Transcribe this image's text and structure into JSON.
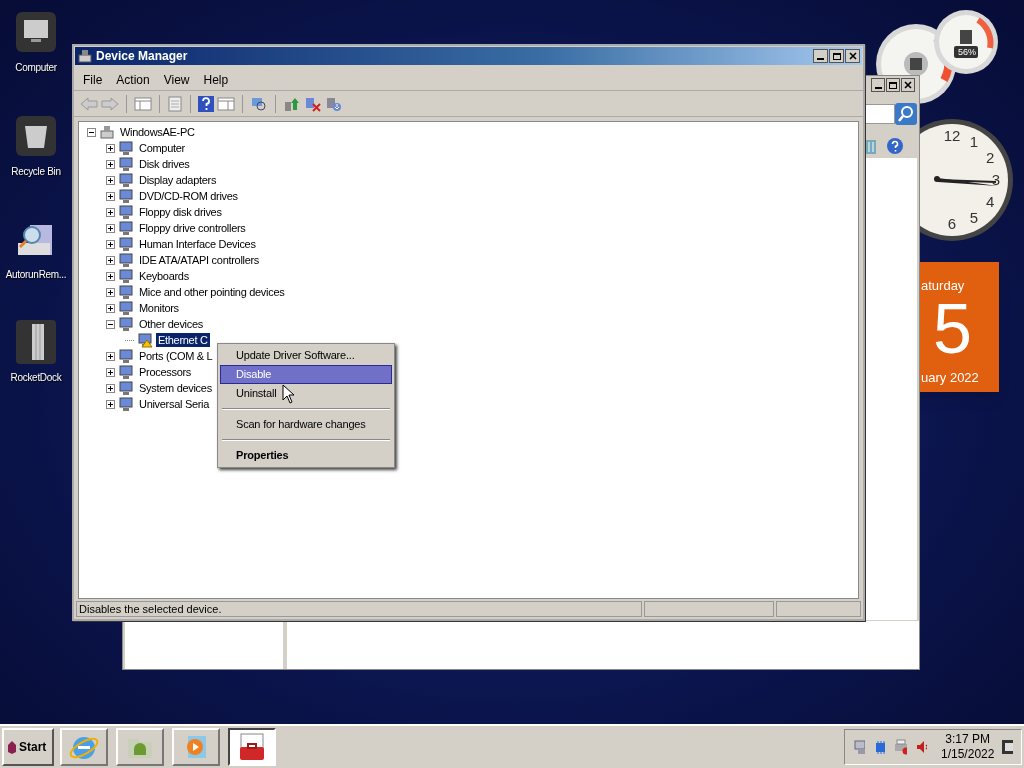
{
  "desktop_icons": [
    {
      "label": "Computer"
    },
    {
      "label": "Recycle Bin"
    },
    {
      "label": "AutorunRem..."
    },
    {
      "label": "RocketDock"
    }
  ],
  "gadgets": {
    "cpu_meter": {
      "reading": "56%"
    },
    "clock": {
      "numbers": [
        "12",
        "1",
        "2",
        "3",
        "4",
        "5",
        "6"
      ]
    },
    "calendar": {
      "weekday": "aturday",
      "day": "5",
      "month": "uary 2022"
    }
  },
  "window": {
    "title": "Device Manager",
    "menu": [
      "File",
      "Action",
      "View",
      "Help"
    ],
    "tree": {
      "label": "WindowsAE-PC",
      "expanded": true,
      "selected": false,
      "children": [
        {
          "label": "Computer",
          "expanded": false,
          "selected": false
        },
        {
          "label": "Disk drives",
          "expanded": false,
          "selected": false
        },
        {
          "label": "Display adapters",
          "expanded": false,
          "selected": false
        },
        {
          "label": "DVD/CD-ROM drives",
          "expanded": false,
          "selected": false
        },
        {
          "label": "Floppy disk drives",
          "expanded": false,
          "selected": false
        },
        {
          "label": "Floppy drive controllers",
          "expanded": false,
          "selected": false
        },
        {
          "label": "Human Interface Devices",
          "expanded": false,
          "selected": false
        },
        {
          "label": "IDE ATA/ATAPI controllers",
          "expanded": false,
          "selected": false
        },
        {
          "label": "Keyboards",
          "expanded": false,
          "selected": false
        },
        {
          "label": "Mice and other pointing devices",
          "expanded": false,
          "selected": false
        },
        {
          "label": "Monitors",
          "expanded": false,
          "selected": false
        },
        {
          "label": "Other devices",
          "expanded": true,
          "selected": false,
          "children": [
            {
              "label": "Ethernet C",
              "selected": true,
              "warning": true
            }
          ]
        },
        {
          "label": "Ports (COM & L",
          "expanded": false,
          "selected": false
        },
        {
          "label": "Processors",
          "expanded": false,
          "selected": false
        },
        {
          "label": "System devices",
          "expanded": false,
          "selected": false
        },
        {
          "label": "Universal Seria",
          "expanded": false,
          "selected": false
        }
      ]
    },
    "status_bar": "Disables the selected device."
  },
  "context_menu": [
    {
      "kind": "item",
      "label": "Update Driver Software...",
      "selected": false
    },
    {
      "kind": "item",
      "label": "Disable",
      "selected": true
    },
    {
      "kind": "item",
      "label": "Uninstall",
      "selected": false
    },
    {
      "kind": "separator"
    },
    {
      "kind": "item",
      "label": "Scan for hardware changes",
      "selected": false
    },
    {
      "kind": "separator"
    },
    {
      "kind": "default",
      "label": "Properties",
      "selected": false
    }
  ],
  "taskbar": {
    "start": "Start",
    "buttons": [
      {
        "selected": false
      },
      {
        "selected": false
      },
      {
        "selected": false
      },
      {
        "selected": true
      }
    ],
    "time": "3:17 PM",
    "date": "1/15/2022"
  }
}
